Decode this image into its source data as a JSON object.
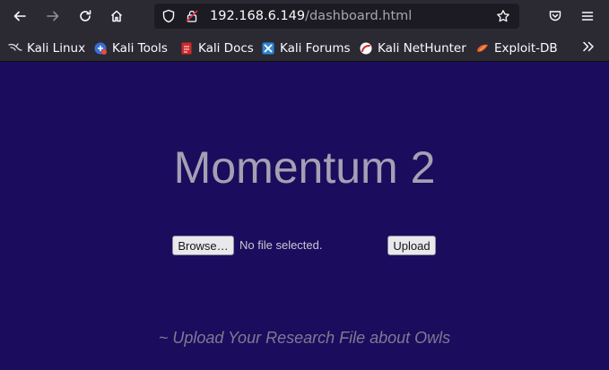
{
  "browser": {
    "url_host": "192.168.6.149",
    "url_path": "/dashboard.html",
    "bookmarks": [
      {
        "label": "Kali Linux",
        "icon": "kali-dragon-icon"
      },
      {
        "label": "Kali Tools",
        "icon": "kali-tools-icon"
      },
      {
        "label": "Kali Docs",
        "icon": "kali-docs-icon"
      },
      {
        "label": "Kali Forums",
        "icon": "kali-forums-icon"
      },
      {
        "label": "Kali NetHunter",
        "icon": "kali-nethunter-icon"
      },
      {
        "label": "Exploit-DB",
        "icon": "exploit-db-icon"
      }
    ]
  },
  "page": {
    "title": "Momentum 2",
    "browse_label": "Browse…",
    "file_status": "No file selected.",
    "upload_label": "Upload",
    "tagline": "~ Upload Your Research File about Owls"
  },
  "colors": {
    "background": "#1c0c5e",
    "title": "#a5a0b3",
    "toolbar": "#2b2a33"
  }
}
